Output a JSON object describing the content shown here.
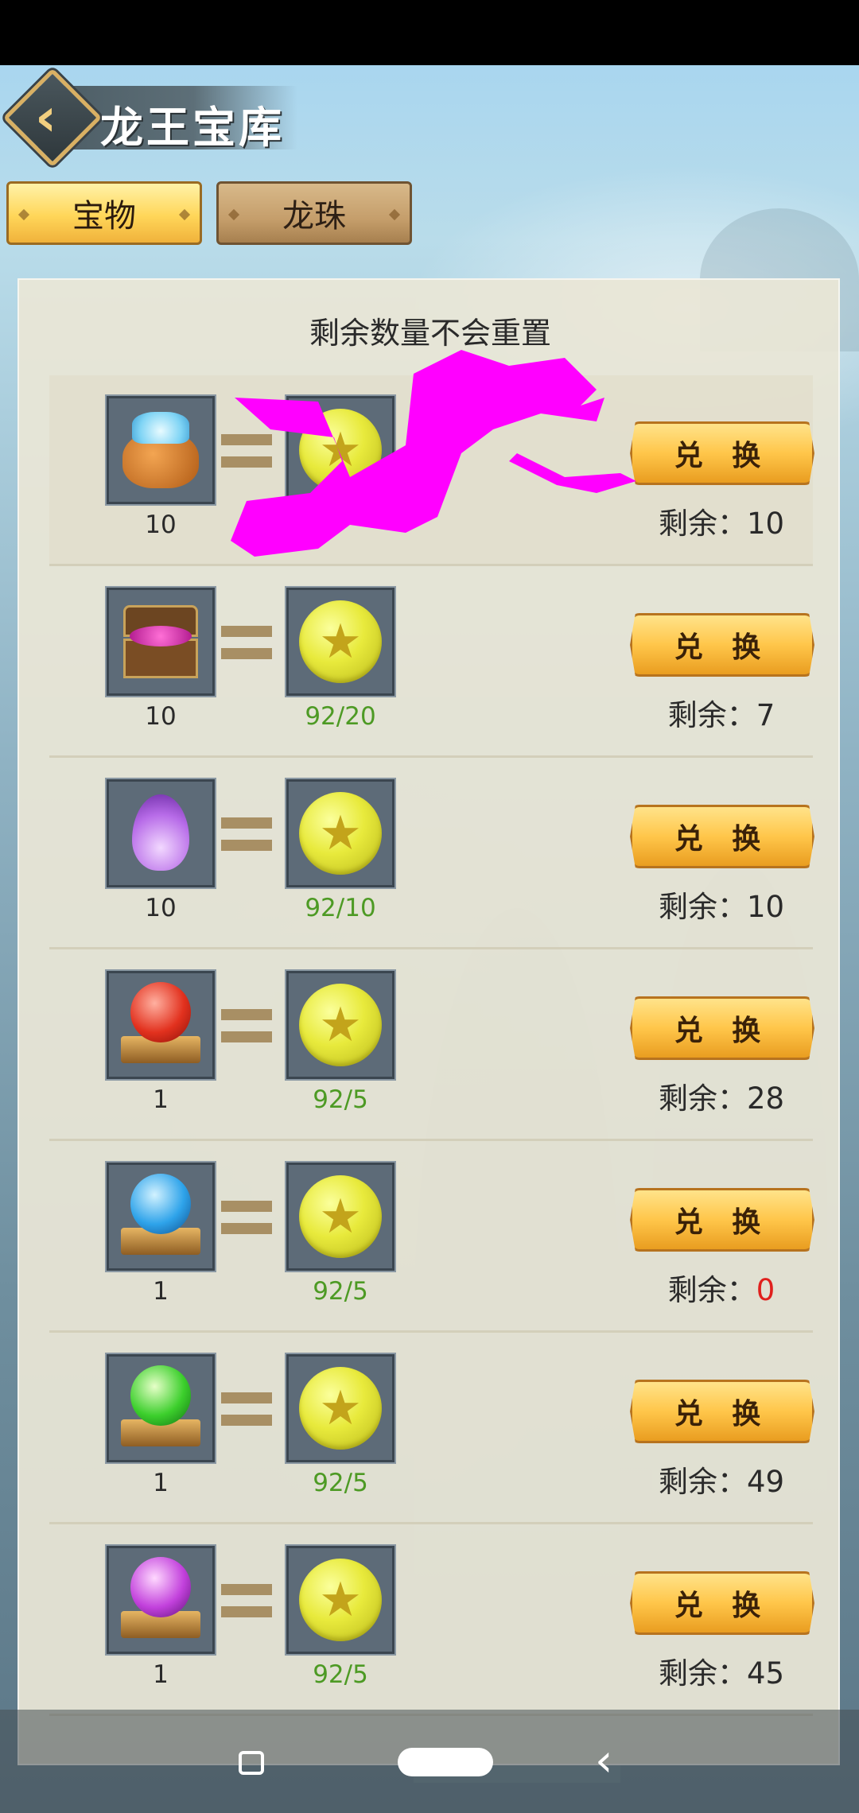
{
  "header": {
    "title": "龙王宝库"
  },
  "tabs": [
    {
      "label": "宝物",
      "active": true
    },
    {
      "label": "龙珠",
      "active": false
    }
  ],
  "notice": "剩余数量不会重置",
  "exchange_label": "兑 换",
  "remain_prefix": "剩余：",
  "rows": [
    {
      "item": "crystal-bag-icon",
      "qty": "10",
      "cost": "",
      "remain": "10",
      "remain_color": "#2a2a2a"
    },
    {
      "item": "treasure-chest-icon",
      "qty": "10",
      "cost": "92/20",
      "remain": "7",
      "remain_color": "#2a2a2a"
    },
    {
      "item": "purple-flame-icon",
      "qty": "10",
      "cost": "92/10",
      "remain": "10",
      "remain_color": "#2a2a2a"
    },
    {
      "item": "red-orb-icon",
      "qty": "1",
      "cost": "92/5",
      "remain": "28",
      "remain_color": "#2a2a2a"
    },
    {
      "item": "blue-orb-icon",
      "qty": "1",
      "cost": "92/5",
      "remain": "0",
      "remain_color": "#e0201d"
    },
    {
      "item": "green-orb-icon",
      "qty": "1",
      "cost": "92/5",
      "remain": "49",
      "remain_color": "#2a2a2a"
    },
    {
      "item": "purple-orb-icon",
      "qty": "1",
      "cost": "92/5",
      "remain": "45",
      "remain_color": "#2a2a2a"
    }
  ],
  "currency_icon": "star-coin-icon",
  "colors": {
    "cost_green": "#4d9a24",
    "zero_red": "#e0201d",
    "button_gold": "#ffc64a",
    "scribble": "#ff00ff"
  },
  "nav": {
    "recents": "square-icon",
    "home": "pill-icon",
    "back": "back-chevron-icon"
  }
}
